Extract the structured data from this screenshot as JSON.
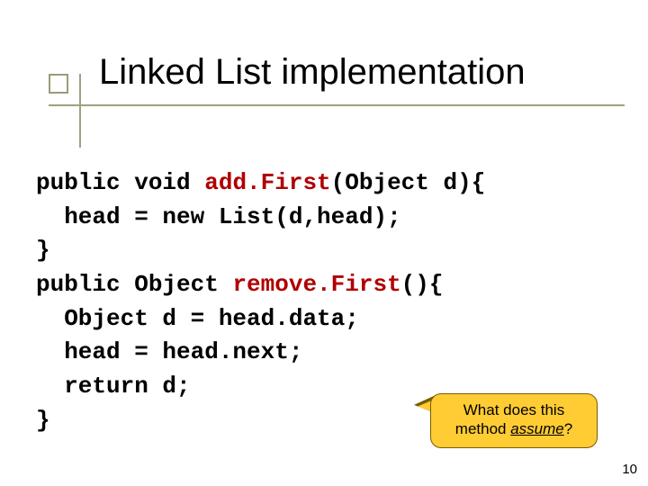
{
  "title": "Linked List implementation",
  "code": {
    "l1a": "public void ",
    "l1m": "add.First",
    "l1b": "(Object d){",
    "l2": "  head = new List(d,head);",
    "l3": "}",
    "l4a": "public Object ",
    "l4m": "remove.First",
    "l4b": "(){",
    "l5": "  Object d = head.data;",
    "l6": "  head = head.next;",
    "l7": "  return d;",
    "l8": "}"
  },
  "callout": {
    "line1": "What does this",
    "line2a": "method ",
    "assume": "assume",
    "qmark": "?"
  },
  "page_number": "10"
}
